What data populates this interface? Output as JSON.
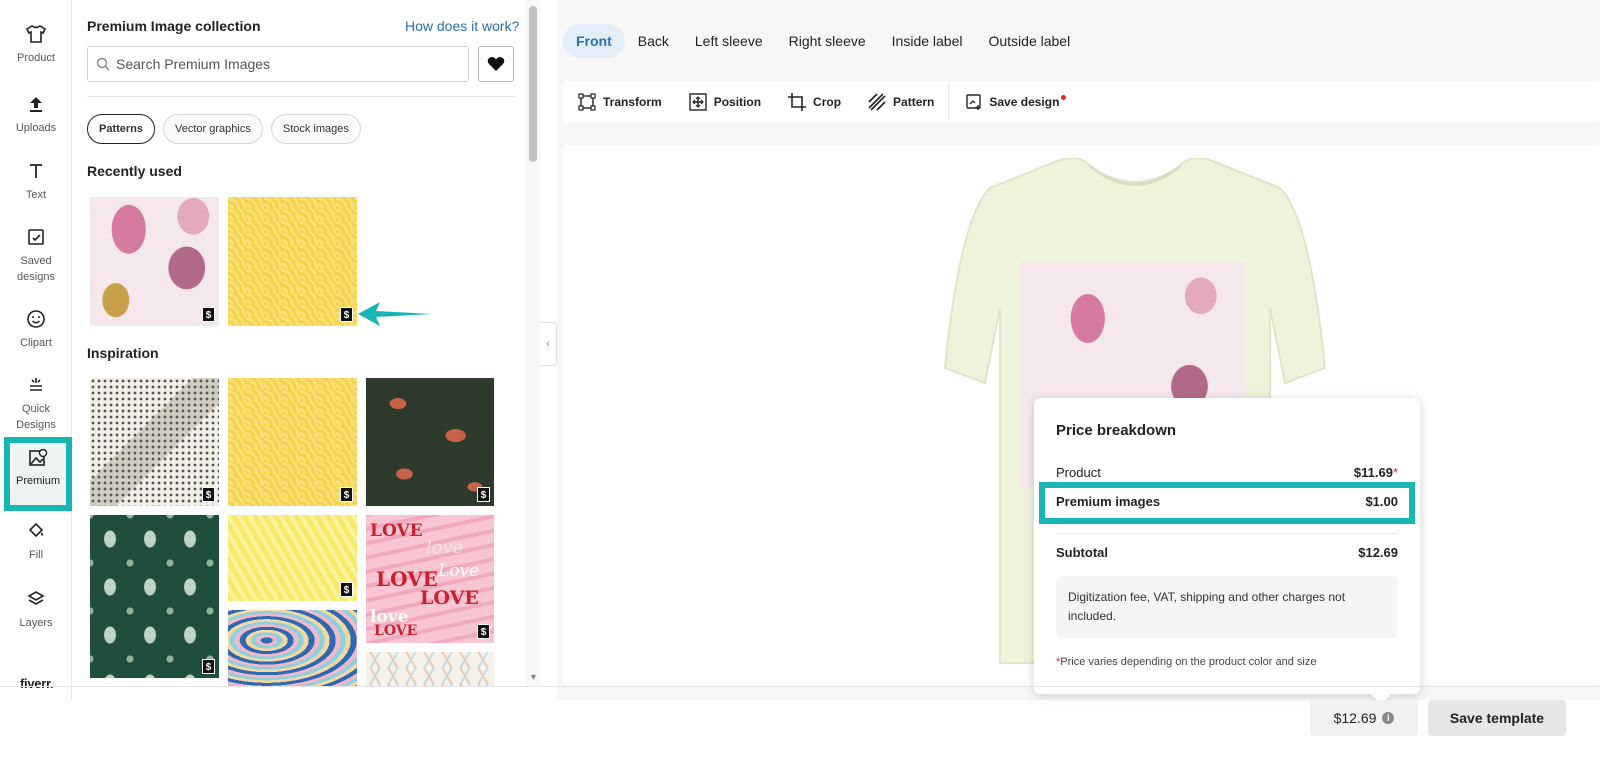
{
  "sidebar": {
    "items": [
      {
        "label": "Product",
        "icon": "tshirt-icon"
      },
      {
        "label": "Uploads",
        "icon": "upload-icon"
      },
      {
        "label": "Text",
        "icon": "text-icon"
      },
      {
        "label": "Saved designs",
        "icon": "saved-designs-icon"
      },
      {
        "label": "Clipart",
        "icon": "smiley-icon"
      },
      {
        "label": "Quick Designs",
        "icon": "magic-wand-icon"
      },
      {
        "label": "Premium",
        "icon": "premium-image-icon",
        "active": true
      },
      {
        "label": "Fill",
        "icon": "paint-bucket-icon"
      },
      {
        "label": "Layers",
        "icon": "layers-icon"
      }
    ],
    "logo": "fiverr."
  },
  "panel": {
    "title": "Premium Image collection",
    "help_link": "How does it work?",
    "search_placeholder": "Search Premium Images",
    "chips": [
      "Patterns",
      "Vector graphics",
      "Stock images"
    ],
    "active_chip": "Patterns",
    "recent_title": "Recently used",
    "inspiration_title": "Inspiration",
    "badge": "$",
    "love_words": [
      "LOVE",
      "love",
      "LOVE",
      "Love",
      "LOVE",
      "love",
      "LOVE"
    ]
  },
  "editor": {
    "tabs": [
      "Front",
      "Back",
      "Left sleeve",
      "Right sleeve",
      "Inside label",
      "Outside label"
    ],
    "active_tab": "Front",
    "tools": [
      "Transform",
      "Position",
      "Crop",
      "Pattern"
    ],
    "save_design": "Save design"
  },
  "price_breakdown": {
    "title": "Price breakdown",
    "product_label": "Product",
    "product_value": "$11.69",
    "premium_label": "Premium images",
    "premium_value": "$1.00",
    "subtotal_label": "Subtotal",
    "subtotal_value": "$12.69",
    "note": "Digitization fee, VAT, shipping and other charges not included.",
    "footnote": "Price varies depending on the product color and size",
    "asterisk": "*"
  },
  "bottom": {
    "price": "$12.69",
    "info": "i",
    "save_template": "Save template"
  },
  "colors": {
    "accent_teal": "#17b6b2",
    "link_blue": "#2a6fb0",
    "shirt": "#eef3dc",
    "required_red": "#e0243a"
  }
}
